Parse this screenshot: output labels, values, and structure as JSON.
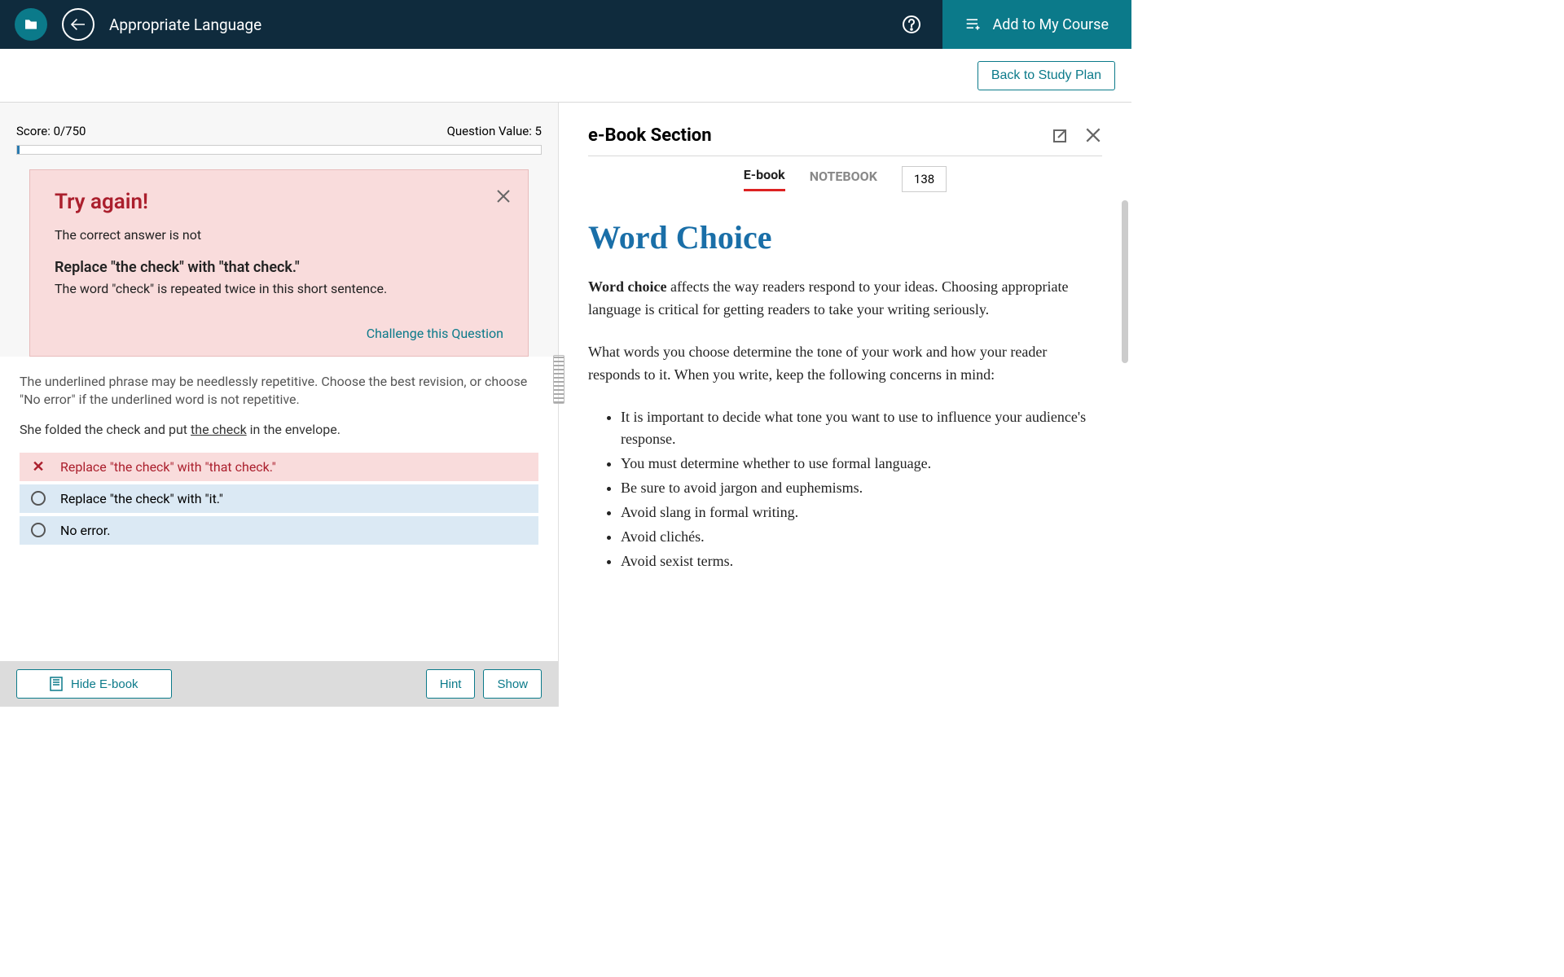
{
  "header": {
    "title": "Appropriate Language",
    "add_course": "Add to My Course"
  },
  "subheader": {
    "study_plan": "Back to Study Plan"
  },
  "quiz": {
    "score_label": "Score: 0/750",
    "question_value_label": "Question Value: 5",
    "feedback": {
      "title": "Try again!",
      "sub": "The correct answer is not",
      "answer": "Replace \"the check\" with \"that check.\"",
      "explanation": "The word \"check\" is repeated twice in this short sentence.",
      "challenge": "Challenge this Question"
    },
    "instruction": "The underlined phrase may be needlessly repetitive. Choose the best revision, or choose \"No error\" if the underlined word is not repetitive.",
    "sentence_pre": "She folded the check and put ",
    "sentence_underlined": "the check",
    "sentence_post": " in the envelope.",
    "options": {
      "a": "Replace \"the check\" with \"that check.\"",
      "b": "Replace \"the check\" with \"it.\"",
      "c": "No error."
    },
    "buttons": {
      "hide": "Hide E-book",
      "hint": "Hint",
      "show": "Show"
    }
  },
  "ebook": {
    "section_title": "e-Book Section",
    "tabs": {
      "ebook": "E-book",
      "notebook": "NOTEBOOK"
    },
    "page": "138",
    "h1": "Word Choice",
    "lead_strong": "Word choice",
    "lead_rest": " affects the way readers respond to your ideas. Choosing appropriate language is critical for getting readers to take your writing seriously.",
    "p2": "What words you choose determine the tone of your work and how your reader responds to it. When you write, keep the following concerns in mind:",
    "bullets": {
      "b1": "It is important to decide what tone you want to use to influence your audience's response.",
      "b2": "You must determine whether to use formal language.",
      "b3": "Be sure to avoid jargon and euphemisms.",
      "b4": "Avoid slang in formal writing.",
      "b5": "Avoid clichés.",
      "b6": "Avoid sexist terms."
    }
  }
}
